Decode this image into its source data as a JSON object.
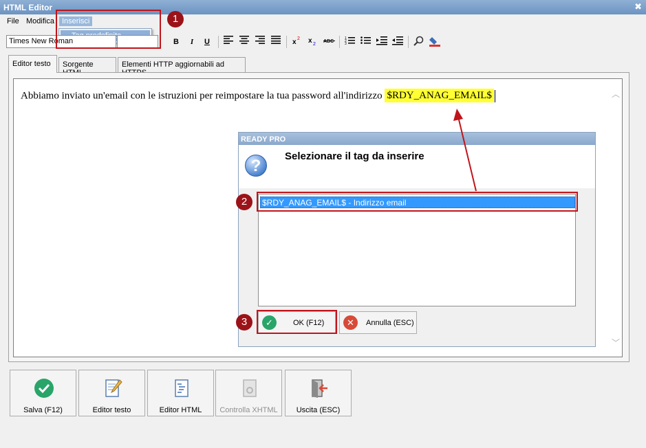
{
  "window": {
    "title": "HTML Editor",
    "close_glyph": "✖"
  },
  "menu": {
    "items": [
      {
        "label": "File"
      },
      {
        "label": "Modifica"
      },
      {
        "label": "Inserisci"
      }
    ],
    "dropdown_item": "Tag predefinito"
  },
  "toolbar": {
    "font_name": "Times New Roman",
    "buttons": [
      "B",
      "I",
      "U"
    ]
  },
  "tabs": [
    {
      "label": "Editor testo",
      "active": true
    },
    {
      "label": "Sorgente HTML",
      "active": false
    },
    {
      "label": "Elementi HTTP aggiornabili ad HTTPS",
      "active": false
    }
  ],
  "editor": {
    "text": "Abbiamo inviato un'email con le istruzioni per reimpostare la tua password all'indirizzo",
    "tag": "$RDY_ANAG_EMAIL$"
  },
  "dialog": {
    "title": "READY PRO",
    "prompt": "Selezionare il tag da inserire",
    "list_items": [
      "$RDY_ANAG_EMAIL$ - Indirizzo email"
    ],
    "ok_label": "OK (F12)",
    "cancel_label": "Annulla (ESC)"
  },
  "annotations": {
    "badges": [
      "1",
      "2",
      "3"
    ],
    "color": "#c0141b"
  },
  "bottom_buttons": [
    {
      "label": "Salva (F12)",
      "enabled": true
    },
    {
      "label": "Editor testo",
      "enabled": true
    },
    {
      "label": "Editor HTML",
      "enabled": true
    },
    {
      "label": "Controlla XHTML",
      "enabled": false
    },
    {
      "label": "Uscita (ESC)",
      "enabled": true
    }
  ],
  "colors": {
    "titlebar": "#7aa0cc",
    "selection": "#3399ff",
    "highlight": "#ffff33",
    "ok_icon": "#2aa56a",
    "cancel_icon": "#d84a38"
  }
}
